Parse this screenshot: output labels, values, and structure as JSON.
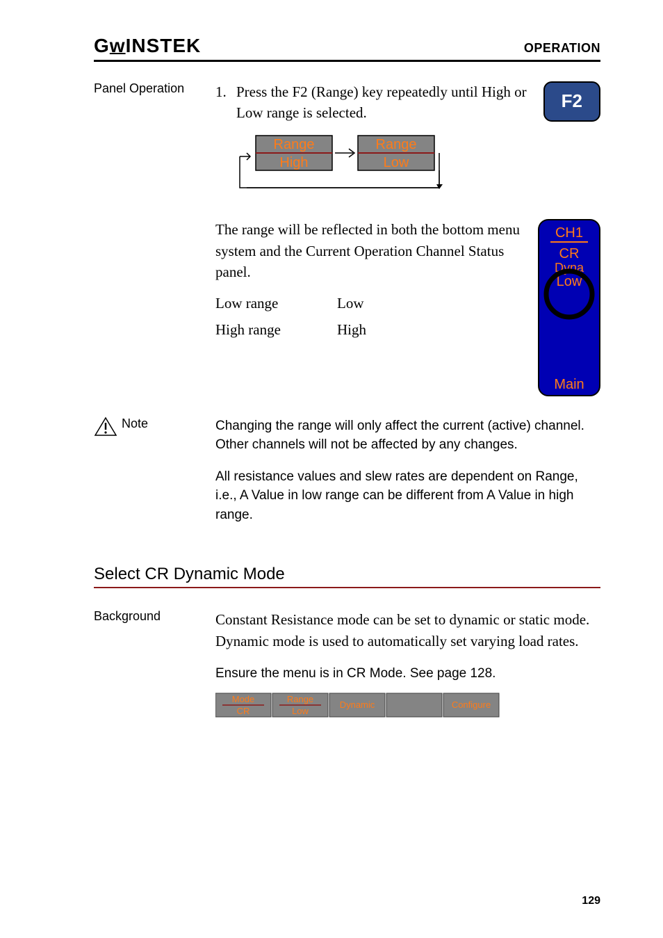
{
  "header": {
    "logo_prefix": "G",
    "logo_under": "w",
    "logo_suffix": "INSTEK",
    "section": "OPERATION"
  },
  "panel_op": {
    "label": "Panel Operation",
    "step_num": "1.",
    "step_text": "Press the F2 (Range) key repeatedly until High or Low range is selected.",
    "f2_label": "F2"
  },
  "range_toggle": {
    "label": "Range",
    "high": "High",
    "low": "Low"
  },
  "reflect": {
    "text": "The range will be reflected in both the bottom menu system and the Current Operation Channel Status panel.",
    "rows": [
      {
        "label": "Low range",
        "val": "Low"
      },
      {
        "label": "High range",
        "val": "High"
      }
    ]
  },
  "status_panel": {
    "ch": "CH1",
    "mode": "CR",
    "dyna": "Dyna",
    "range": "Low",
    "main": "Main"
  },
  "note": {
    "label": "Note",
    "p1": "Changing the range will only affect the current (active) channel. Other channels will not be affected by any changes.",
    "p2": "All resistance values and slew rates are dependent on Range, i.e., A Value in low range can be different from A Value in high range."
  },
  "cr_dynamic": {
    "heading": "Select CR Dynamic Mode",
    "bg_label": "Background",
    "bg_text": "Constant Resistance mode can be set to dynamic or static mode. Dynamic mode is used to automatically set varying load rates.",
    "ensure": "Ensure the menu is in CR Mode. See page 128."
  },
  "menu": {
    "mode_label": "Mode",
    "mode_val": "CR",
    "range_label": "Range",
    "range_val": "Low",
    "dynamic": "Dynamic",
    "configure": "Configure"
  },
  "page_number": "129"
}
